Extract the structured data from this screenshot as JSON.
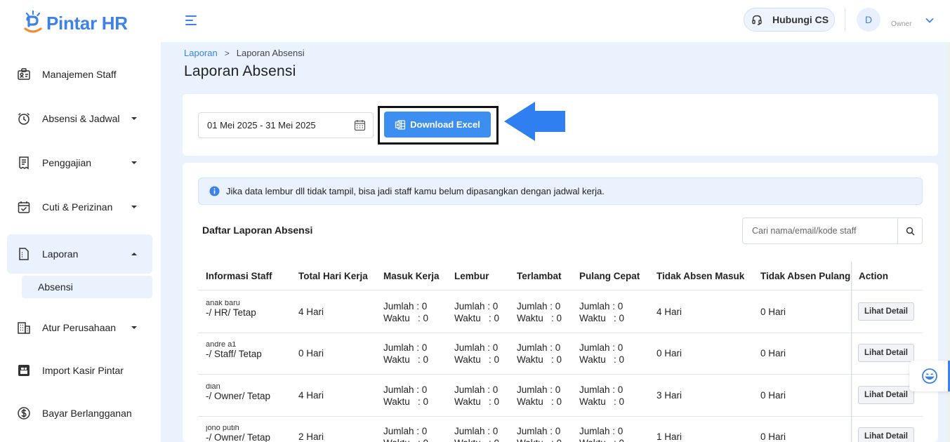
{
  "brand": {
    "name": "Pintar HR",
    "accent": "#3c82e8"
  },
  "sidebar": {
    "items": [
      {
        "label": "Manajemen Staff",
        "icon": "staff-id-icon"
      },
      {
        "label": "Absensi & Jadwal",
        "icon": "alarm-clock-icon"
      },
      {
        "label": "Penggajian",
        "icon": "receipt-icon"
      },
      {
        "label": "Cuti & Perizinan",
        "icon": "calendar-check-icon"
      },
      {
        "label": "Laporan",
        "icon": "report-icon"
      },
      {
        "label": "Atur Perusahaan",
        "icon": "building-icon"
      },
      {
        "label": "Import Kasir Pintar",
        "icon": "import-icon"
      },
      {
        "label": "Bayar Berlangganan",
        "icon": "dollar-circle-icon"
      }
    ],
    "sub_items": [
      {
        "label": "Absensi"
      }
    ]
  },
  "topbar": {
    "cs_label": "Hubungi CS",
    "avatar_initial": "D",
    "role": "Owner"
  },
  "breadcrumb": {
    "parent": "Laporan",
    "separator": ">",
    "current": "Laporan Absensi"
  },
  "page_title": "Laporan Absensi",
  "filter": {
    "date_range": "01 Mei 2025 - 31 Mei 2025",
    "download_label": "Download Excel"
  },
  "alert": {
    "text": "Jika data lembur dll tidak tampil, bisa jadi staff kamu belum dipasangkan dengan jadwal kerja."
  },
  "list": {
    "title": "Daftar Laporan Absensi",
    "search_placeholder": "Cari nama/email/kode staff"
  },
  "table": {
    "columns": [
      "Informasi Staff",
      "Total Hari Kerja",
      "Masuk Kerja",
      "Lembur",
      "Terlambat",
      "Pulang Cepat",
      "Tidak Absen Masuk",
      "Tidak Absen Pulang",
      "Action"
    ],
    "count_line": "Jumlah : 0",
    "time_line": "Waktu   : 0",
    "action_label": "Lihat Detail",
    "rows": [
      {
        "name": "anak baru",
        "info": "-/ HR/ Tetap",
        "total": "4 Hari",
        "tidak_masuk": "4 Hari",
        "tidak_pulang": "0 Hari"
      },
      {
        "name": "andre a1",
        "info": "-/ Staff/ Tetap",
        "total": "0 Hari",
        "tidak_masuk": "0 Hari",
        "tidak_pulang": "0 Hari"
      },
      {
        "name": "dian",
        "info": "-/ Owner/ Tetap",
        "total": "4 Hari",
        "tidak_masuk": "3 Hari",
        "tidak_pulang": "0 Hari"
      },
      {
        "name": "jono putih",
        "info": "-/ Owner/ Tetap",
        "total": "2 Hari",
        "tidak_masuk": "1 Hari",
        "tidak_pulang": "0 Hari"
      }
    ]
  }
}
